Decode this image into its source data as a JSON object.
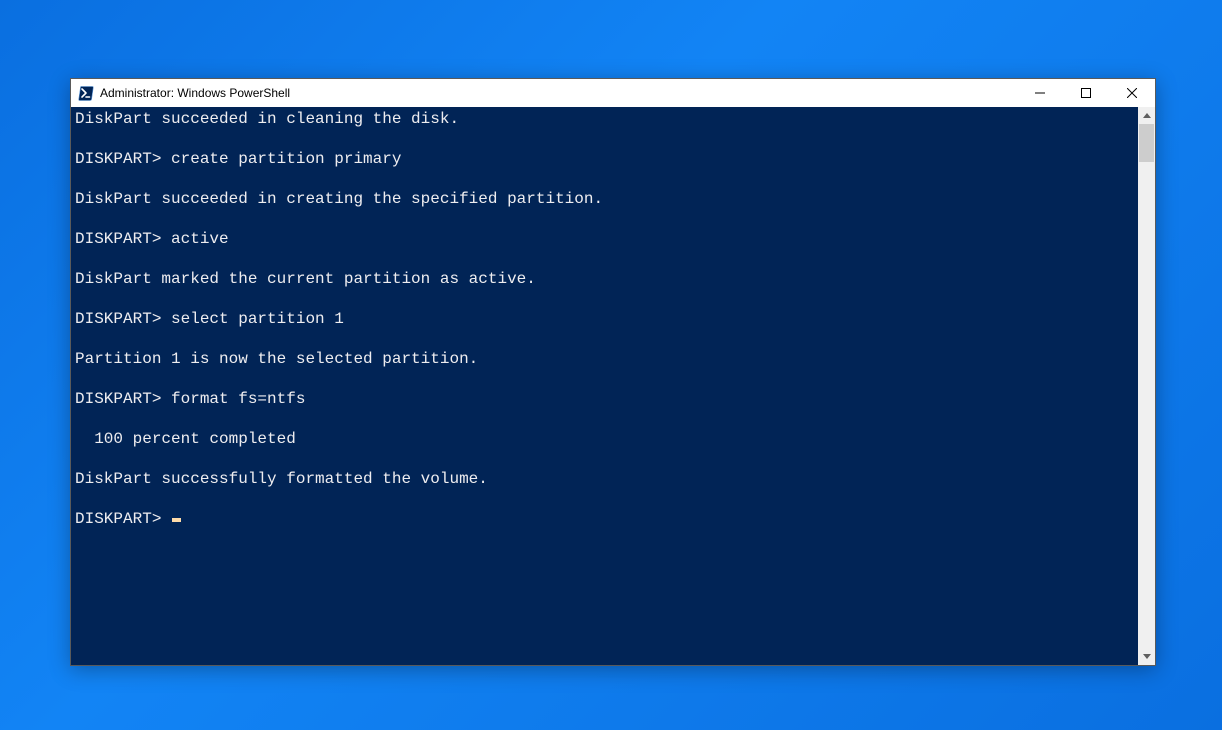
{
  "window": {
    "title": "Administrator: Windows PowerShell"
  },
  "terminal": {
    "prompt": "DISKPART>",
    "lines": [
      "DiskPart succeeded in cleaning the disk.",
      "",
      "DISKPART> create partition primary",
      "",
      "DiskPart succeeded in creating the specified partition.",
      "",
      "DISKPART> active",
      "",
      "DiskPart marked the current partition as active.",
      "",
      "DISKPART> select partition 1",
      "",
      "Partition 1 is now the selected partition.",
      "",
      "DISKPART> format fs=ntfs",
      "",
      "  100 percent completed",
      "",
      "DiskPart successfully formatted the volume.",
      "",
      "DISKPART> "
    ]
  }
}
